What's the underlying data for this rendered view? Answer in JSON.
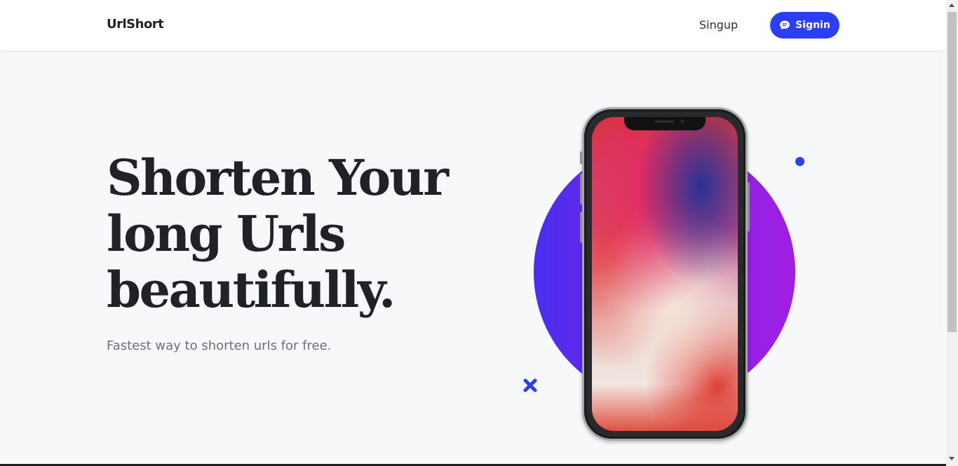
{
  "navbar": {
    "brand": "UrlShort",
    "signup_label": "Singup",
    "signin_label": "Signin",
    "signin_icon": "chat-bubble-icon"
  },
  "hero": {
    "title_lines": [
      "Shorten Your",
      "long Urls",
      "beautifully."
    ],
    "subtitle": "Fastest way to shorten urls for free."
  },
  "illustration": {
    "phone_image": "smartphone-mockup",
    "circle_gradient": [
      "#4a2ef0",
      "#a21ee3"
    ],
    "decorations": [
      "dot-icon",
      "cross-icon"
    ]
  },
  "colors": {
    "accent": "#2b3ef0",
    "text_dark": "#1f2328",
    "text_muted": "#6b6f78",
    "background": "#f7f8fa"
  }
}
